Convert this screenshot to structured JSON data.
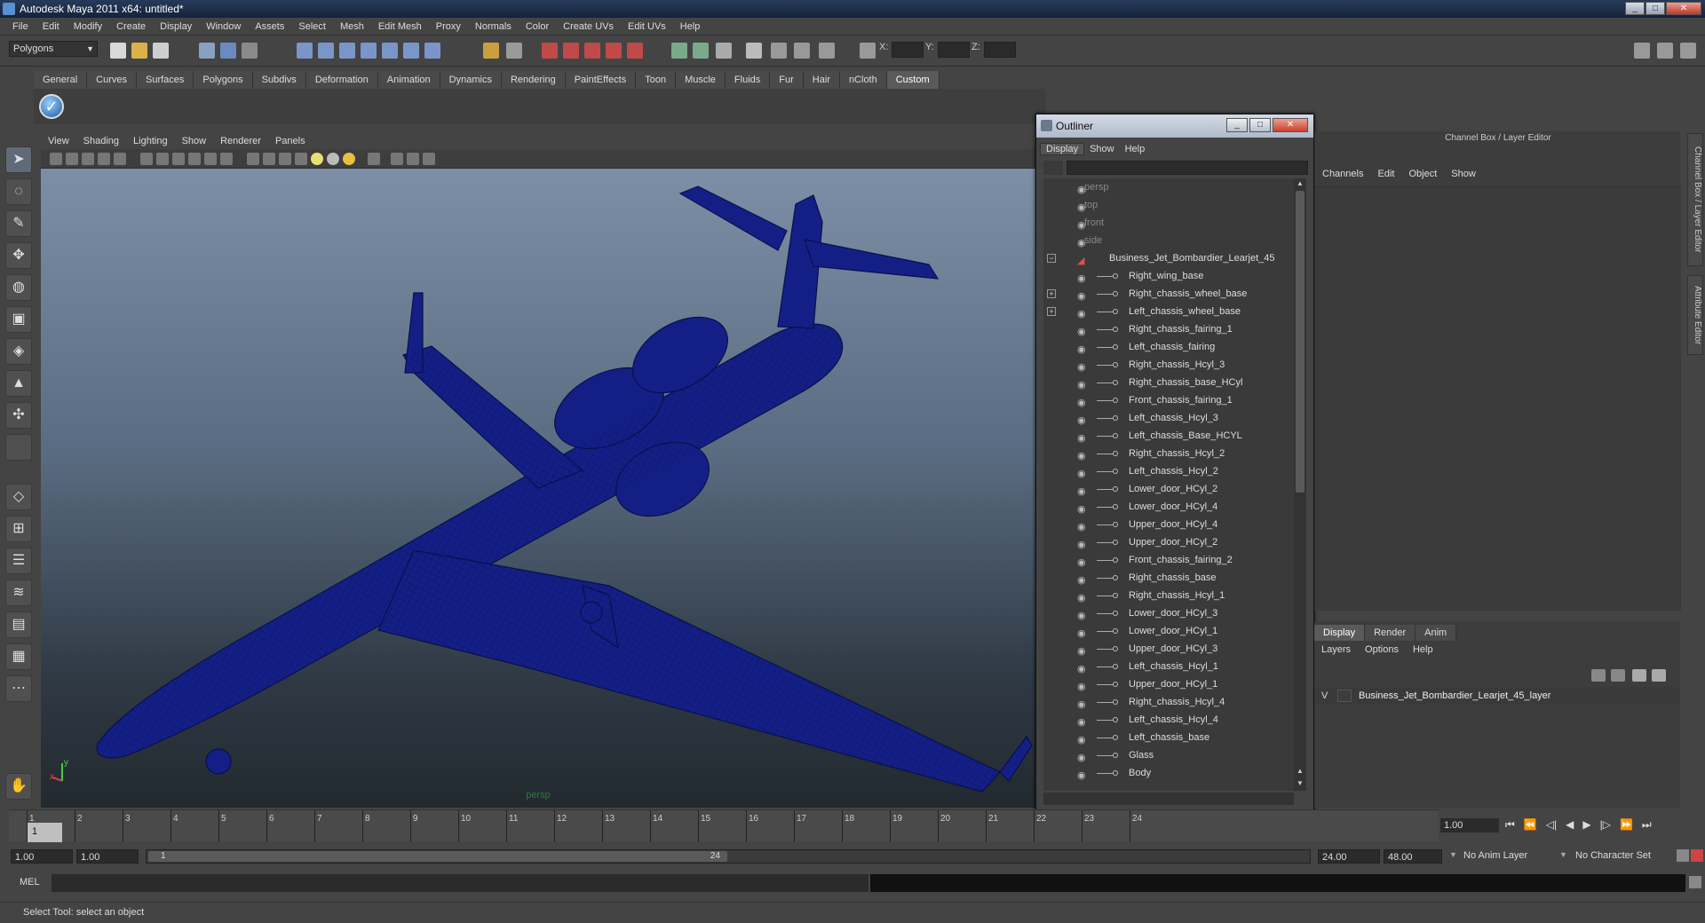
{
  "window": {
    "title": "Autodesk Maya 2011 x64: untitled*"
  },
  "menubar": [
    "File",
    "Edit",
    "Modify",
    "Create",
    "Display",
    "Window",
    "Assets",
    "Select",
    "Mesh",
    "Edit Mesh",
    "Proxy",
    "Normals",
    "Color",
    "Create UVs",
    "Edit UVs",
    "Help"
  ],
  "statusline": {
    "mode": "Polygons",
    "x_label": "X:",
    "y_label": "Y:",
    "z_label": "Z:"
  },
  "shelf_tabs": [
    "General",
    "Curves",
    "Surfaces",
    "Polygons",
    "Subdivs",
    "Deformation",
    "Animation",
    "Dynamics",
    "Rendering",
    "PaintEffects",
    "Toon",
    "Muscle",
    "Fluids",
    "Fur",
    "Hair",
    "nCloth",
    "Custom"
  ],
  "shelf_active": "Custom",
  "viewport": {
    "menu": [
      "View",
      "Shading",
      "Lighting",
      "Show",
      "Renderer",
      "Panels"
    ],
    "camera_label": "persp",
    "axis_x": "x",
    "axis_y": "y"
  },
  "outliner": {
    "title": "Outliner",
    "menu": [
      "Display",
      "Show",
      "Help"
    ],
    "cameras": [
      "persp",
      "top",
      "front",
      "side"
    ],
    "root": "Business_Jet_Bombardier_Learjet_45",
    "children": [
      "Right_wing_base",
      "Right_chassis_wheel_base",
      "Left_chassis_wheel_base",
      "Right_chassis_fairing_1",
      "Left_chassis_fairing",
      "Right_chassis_Hcyl_3",
      "Right_chassis_base_HCyl",
      "Front_chassis_fairing_1",
      "Left_chassis_Hcyl_3",
      "Left_chassis_Base_HCYL",
      "Right_chassis_Hcyl_2",
      "Left_chassis_Hcyl_2",
      "Lower_door_HCyl_2",
      "Lower_door_HCyl_4",
      "Upper_door_HCyl_4",
      "Upper_door_HCyl_2",
      "Front_chassis_fairing_2",
      "Right_chassis_base",
      "Right_chassis_Hcyl_1",
      "Lower_door_HCyl_3",
      "Lower_door_HCyl_1",
      "Upper_door_HCyl_3",
      "Left_chassis_Hcyl_1",
      "Upper_door_HCyl_1",
      "Right_chassis_Hcyl_4",
      "Left_chassis_Hcyl_4",
      "Left_chassis_base",
      "Glass",
      "Body"
    ],
    "expandable": [
      "Right_chassis_wheel_base",
      "Left_chassis_wheel_base"
    ]
  },
  "channel_box": {
    "title": "Channel Box / Layer Editor",
    "menu": [
      "Channels",
      "Edit",
      "Object",
      "Show"
    ]
  },
  "layer_editor": {
    "tabs": [
      "Display",
      "Render",
      "Anim"
    ],
    "menu": [
      "Layers",
      "Options",
      "Help"
    ],
    "visibility": "V",
    "layer_name": "Business_Jet_Bombardier_Learjet_45_layer"
  },
  "side_tabs": [
    "Channel Box / Layer Editor",
    "Attribute Editor"
  ],
  "timeline": {
    "ticks": [
      "1",
      "2",
      "3",
      "4",
      "5",
      "6",
      "7",
      "8",
      "9",
      "10",
      "11",
      "12",
      "13",
      "14",
      "15",
      "16",
      "17",
      "18",
      "19",
      "20",
      "21",
      "22",
      "23",
      "24"
    ],
    "current_frame": "1.00",
    "playhead_label": "1"
  },
  "range": {
    "start": "1.00",
    "anim_start": "1.00",
    "slider_start": "1",
    "slider_end": "24",
    "anim_end": "24.00",
    "end": "48.00",
    "anim_layer": "No Anim Layer",
    "character_set": "No Character Set"
  },
  "mel": {
    "label": "MEL"
  },
  "help_line": "Select Tool: select an object",
  "colors": {
    "wireframe": "#0d1a7a",
    "viewport_top": "#7c8fa6",
    "viewport_bottom": "#22292f"
  }
}
